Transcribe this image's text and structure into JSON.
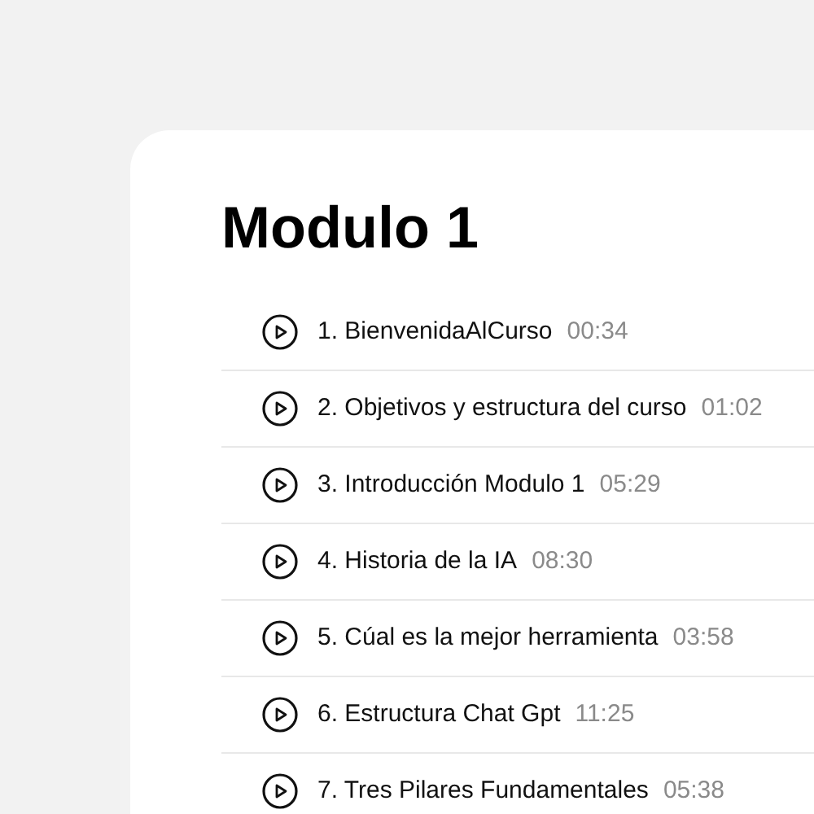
{
  "module": {
    "title": "Modulo 1",
    "lessons": [
      {
        "title": "1. BienvenidaAlCurso",
        "duration": "00:34"
      },
      {
        "title": "2. Objetivos y estructura del curso",
        "duration": "01:02"
      },
      {
        "title": "3. Introducción Modulo 1",
        "duration": "05:29"
      },
      {
        "title": "4. Historia de la IA",
        "duration": "08:30"
      },
      {
        "title": "5. Cúal es la mejor herramienta",
        "duration": "03:58"
      },
      {
        "title": "6. Estructura Chat Gpt",
        "duration": "11:25"
      },
      {
        "title": "7. Tres Pilares Fundamentales",
        "duration": "05:38"
      }
    ]
  }
}
